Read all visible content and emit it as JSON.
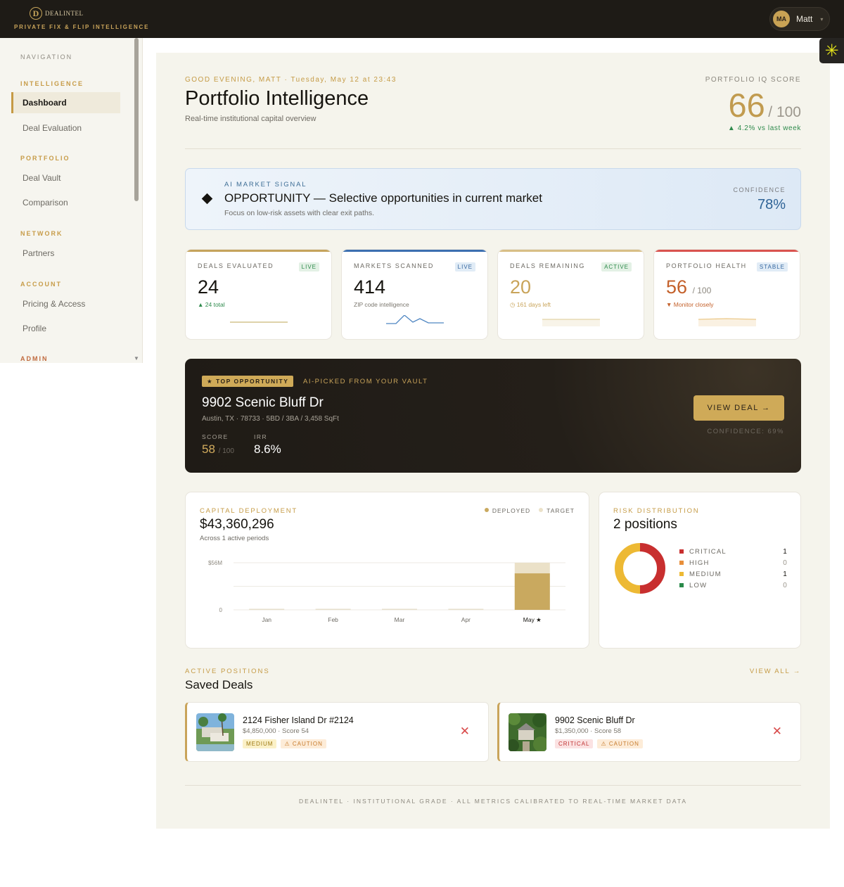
{
  "brand": {
    "logo_text": "DEALINTEL",
    "tagline": "PRIVATE FIX & FLIP INTELLIGENCE"
  },
  "user": {
    "initials": "MA",
    "name": "Matt",
    "caret": "▾"
  },
  "sidebar": {
    "title": "NAVIGATION",
    "sections": [
      {
        "heading": "INTELLIGENCE",
        "items": [
          "Dashboard",
          "Deal Evaluation"
        ]
      },
      {
        "heading": "PORTFOLIO",
        "items": [
          "Deal Vault",
          "Comparison"
        ]
      },
      {
        "heading": "NETWORK",
        "items": [
          "Partners"
        ]
      },
      {
        "heading": "ACCOUNT",
        "items": [
          "Pricing & Access",
          "Profile"
        ]
      },
      {
        "heading": "ADMIN",
        "items": []
      }
    ],
    "active_item": "Dashboard"
  },
  "header": {
    "greeting": "GOOD EVENING, MATT · Tuesday, May 12 at 23:43",
    "title": "Portfolio Intelligence",
    "subtitle": "Real-time institutional capital overview",
    "iq_label": "PORTFOLIO IQ SCORE",
    "iq_score": "66",
    "iq_denominator": "/ 100",
    "iq_delta": "▲ 4.2% vs last week"
  },
  "signal": {
    "label": "AI MARKET SIGNAL",
    "title": "OPPORTUNITY — Selective opportunities in current market",
    "description": "Focus on low-risk assets with clear exit paths.",
    "confidence_label": "CONFIDENCE",
    "confidence_value": "78%"
  },
  "kpis": [
    {
      "label": "DEALS EVALUATED",
      "badge": "LIVE",
      "value": "24",
      "denominator": "",
      "sub": "▲ 24 total",
      "accent": "#c5a35c",
      "value_color": "#16140f",
      "sub_color": "#2e8a4c",
      "badge_bg": "#e3f1e5",
      "badge_color": "#2e8a4c"
    },
    {
      "label": "MARKETS SCANNED",
      "badge": "LIVE",
      "value": "414",
      "denominator": "",
      "sub": "ZIP code intelligence",
      "accent": "#3c6fb0",
      "value_color": "#16140f",
      "sub_color": "#7b776e",
      "badge_bg": "#e1ecf6",
      "badge_color": "#3567a0"
    },
    {
      "label": "DEALS REMAINING",
      "badge": "ACTIVE",
      "value": "20",
      "denominator": "",
      "sub": "◷ 161 days left",
      "accent": "#d8be86",
      "value_color": "#c9a45a",
      "sub_color": "#c9a45a",
      "badge_bg": "#e3f1e5",
      "badge_color": "#2e8a4c"
    },
    {
      "label": "PORTFOLIO HEALTH",
      "badge": "STABLE",
      "value": "56",
      "denominator": "/ 100",
      "sub": "▼ Monitor closely",
      "accent": "#d9534f",
      "value_color": "#c4612b",
      "sub_color": "#c4612b",
      "badge_bg": "#e1ecf6",
      "badge_color": "#3567a0"
    }
  ],
  "top_opportunity": {
    "badge": "★ TOP OPPORTUNITY",
    "picked": "AI-PICKED FROM YOUR VAULT",
    "title": "9902 Scenic Bluff Dr",
    "meta": "Austin, TX · 78733 · 5BD / 3BA / 3,458 SqFt",
    "score_label": "SCORE",
    "score_value": "58",
    "score_den": "/ 100",
    "irr_label": "IRR",
    "irr_value": "8.6%",
    "button": "VIEW DEAL →",
    "confidence": "CONFIDENCE: 69%"
  },
  "capital": {
    "label": "CAPITAL DEPLOYMENT",
    "amount": "$43,360,296",
    "sub": "Across 1 active periods",
    "legend_deployed": "DEPLOYED",
    "legend_target": "TARGET"
  },
  "chart_data": {
    "type": "bar",
    "categories": [
      "Jan",
      "Feb",
      "Mar",
      "Apr",
      "May ★"
    ],
    "series": [
      {
        "name": "DEPLOYED",
        "values": [
          0,
          0,
          0,
          0,
          43360296
        ],
        "color": "#c9a95f"
      },
      {
        "name": "TARGET",
        "values": [
          0,
          0,
          0,
          0,
          56000000
        ],
        "color": "#ebe1c8"
      }
    ],
    "yticks": [
      "$56M",
      "0"
    ],
    "ylim": [
      0,
      56000000
    ]
  },
  "risk": {
    "label": "RISK DISTRIBUTION",
    "title": "2 positions",
    "levels": [
      {
        "name": "CRITICAL",
        "count": "1",
        "color": "#c82f2f"
      },
      {
        "name": "HIGH",
        "count": "0",
        "color": "#e88f3a"
      },
      {
        "name": "MEDIUM",
        "count": "1",
        "color": "#edb934"
      },
      {
        "name": "LOW",
        "count": "0",
        "color": "#2a8a4a"
      }
    ]
  },
  "positions": {
    "label": "ACTIVE POSITIONS",
    "title": "Saved Deals",
    "view_all": "VIEW ALL →",
    "deals": [
      {
        "name": "2124 Fisher Island Dr #2124",
        "meta": "$4,850,000 · Score 54",
        "risk_tag": "MEDIUM",
        "warn_tag": "⚠ CAUTION",
        "risk_bg": "#fbf1c8",
        "risk_color": "#9c7710"
      },
      {
        "name": "9902 Scenic Bluff Dr",
        "meta": "$1,350,000 · Score 58",
        "risk_tag": "CRITICAL",
        "warn_tag": "⚠ CAUTION",
        "risk_bg": "#fbe2e2",
        "risk_color": "#c03333"
      }
    ]
  },
  "footer": "DEALINTEL · INSTITUTIONAL GRADE · ALL METRICS CALIBRATED TO REAL-TIME MARKET DATA"
}
